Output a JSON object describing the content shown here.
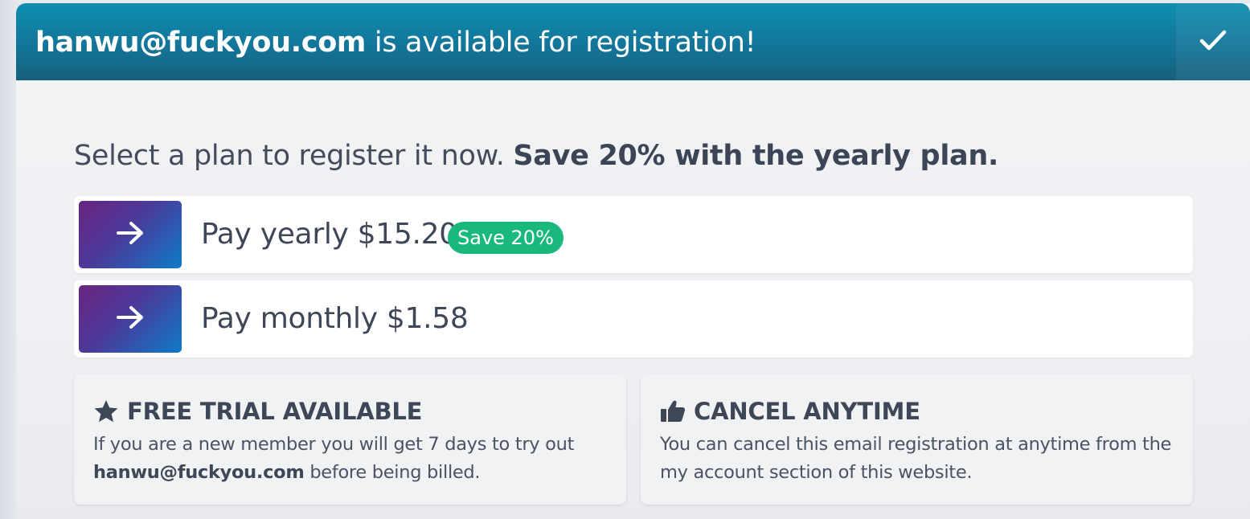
{
  "header": {
    "email": "hanwu@fuckyou.com",
    "message": " is available for registration!",
    "confirm_icon": "check-icon"
  },
  "intro": {
    "text": "Select a plan to register it now. ",
    "emphasis": "Save 20% with the yearly plan."
  },
  "plans": [
    {
      "label": "Pay yearly $15.20",
      "badge": "Save 20%",
      "icon": "arrow-right-icon"
    },
    {
      "label": "Pay monthly $1.58",
      "icon": "arrow-right-icon"
    }
  ],
  "cards": {
    "trial": {
      "icon": "star-icon",
      "title": "FREE TRIAL AVAILABLE",
      "body_before": "If you are a new member you will get 7 days to try out ",
      "body_email": "hanwu@fuckyou.com",
      "body_after": " before being billed."
    },
    "cancel": {
      "icon": "thumbs-up-icon",
      "title": "CANCEL ANYTIME",
      "body": "You can cancel this email registration at anytime from the my account section of this website."
    }
  },
  "colors": {
    "header_top": "#0d8fb0",
    "header_bottom": "#16607c",
    "badge": "#19b97e",
    "arrow_gradient_start": "#6a2480",
    "arrow_gradient_end": "#0e7bc8"
  }
}
